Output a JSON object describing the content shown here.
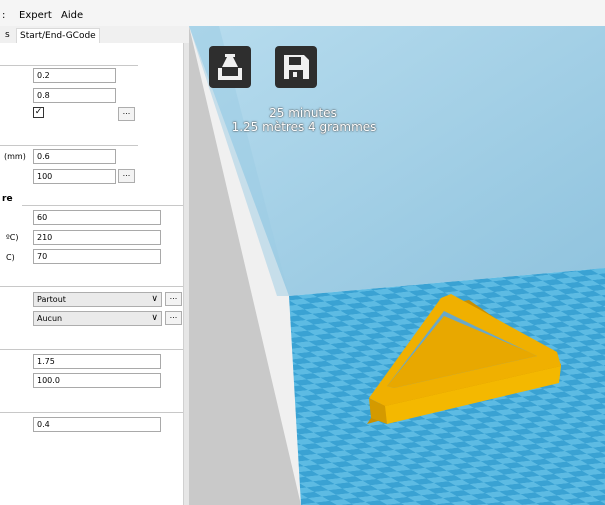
{
  "menu": {
    "item_partial": ":",
    "expert": "Expert",
    "aide": "Aide"
  },
  "tabs": {
    "partial": "s",
    "active": "Start/End-GCode"
  },
  "settings": {
    "layer_height": "0.2",
    "shell_thickness": "0.8",
    "retraction_checked": "✓",
    "bottom_top_label": "(mm)",
    "bottom_top_thickness": "0.6",
    "fill_density": "100",
    "speed_section_label": "re",
    "print_speed": "60",
    "temp_label": "ºC)",
    "print_temp": "210",
    "bed_label": "C)",
    "bed_temp": "70",
    "support_type": "Partout",
    "platform_adhesion": "Aucun",
    "filament_diameter": "1.75",
    "flow": "100.0",
    "nozzle_size": "0.4",
    "dots_label": "...",
    "chevron": "∨"
  },
  "viewport": {
    "time": "25 minutes",
    "material": "1.25 mètres 4 grammes",
    "load_icon": "load-model-icon",
    "save_icon": "save-gcode-icon",
    "colors": {
      "wall": "#c9c9c9",
      "sky": "#a6d0e8",
      "floor_dark": "#3aa2d3",
      "floor_light": "#5dbbe3",
      "model": "#f0b000"
    }
  }
}
